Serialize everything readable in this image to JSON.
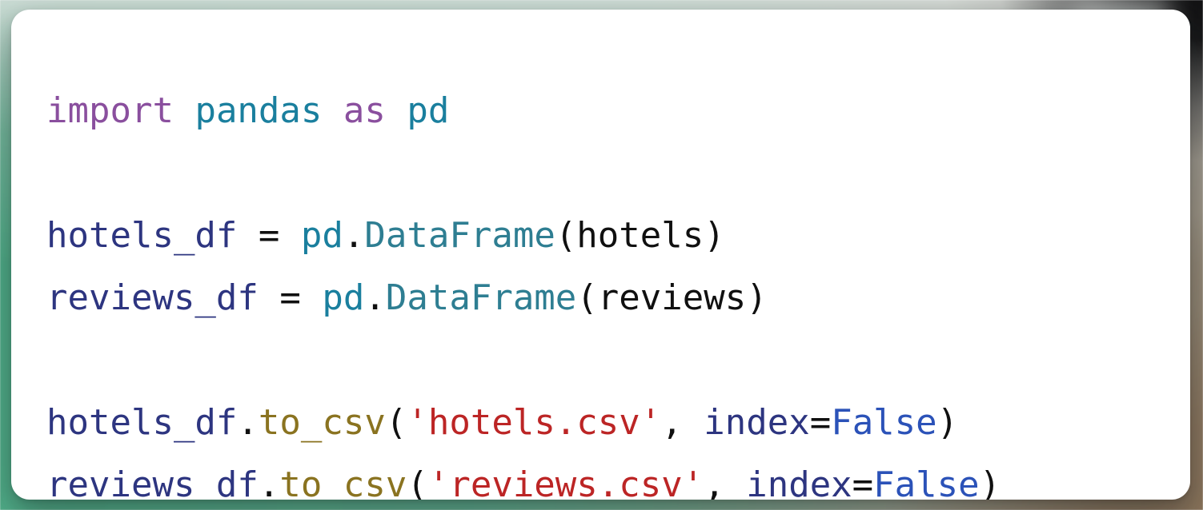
{
  "card": {
    "background_color": "#ffffff",
    "corner_radius_px": 23
  },
  "backdrop": {
    "description": "blurred photographic background",
    "green": "#5cb491",
    "tan": "#8d7861",
    "dark": "#0a0a0c",
    "haze": "#e1e4e2"
  },
  "code": {
    "language": "python",
    "font_size_px": 44,
    "lines": [
      {
        "id": "line-1",
        "tokens": [
          {
            "text": "import",
            "type": "keyword"
          },
          {
            "text": " ",
            "type": "plain"
          },
          {
            "text": "pandas",
            "type": "module"
          },
          {
            "text": " ",
            "type": "plain"
          },
          {
            "text": "as",
            "type": "keyword"
          },
          {
            "text": " ",
            "type": "plain"
          },
          {
            "text": "pd",
            "type": "module"
          }
        ]
      },
      {
        "id": "line-2",
        "tokens": []
      },
      {
        "id": "line-3",
        "tokens": [
          {
            "text": "hotels_df",
            "type": "var"
          },
          {
            "text": " = ",
            "type": "plain"
          },
          {
            "text": "pd",
            "type": "module"
          },
          {
            "text": ".",
            "type": "plain"
          },
          {
            "text": "DataFrame",
            "type": "class"
          },
          {
            "text": "(hotels)",
            "type": "plain"
          }
        ]
      },
      {
        "id": "line-4",
        "tokens": [
          {
            "text": "reviews_df",
            "type": "var"
          },
          {
            "text": " = ",
            "type": "plain"
          },
          {
            "text": "pd",
            "type": "module"
          },
          {
            "text": ".",
            "type": "plain"
          },
          {
            "text": "DataFrame",
            "type": "class"
          },
          {
            "text": "(reviews)",
            "type": "plain"
          }
        ]
      },
      {
        "id": "line-5",
        "tokens": []
      },
      {
        "id": "line-6",
        "tokens": [
          {
            "text": "hotels_df",
            "type": "var"
          },
          {
            "text": ".",
            "type": "plain"
          },
          {
            "text": "to_csv",
            "type": "method"
          },
          {
            "text": "(",
            "type": "plain"
          },
          {
            "text": "'hotels.csv'",
            "type": "string"
          },
          {
            "text": ", ",
            "type": "plain"
          },
          {
            "text": "index",
            "type": "var"
          },
          {
            "text": "=",
            "type": "plain"
          },
          {
            "text": "False",
            "type": "const"
          },
          {
            "text": ")",
            "type": "plain"
          }
        ]
      },
      {
        "id": "line-7",
        "tokens": [
          {
            "text": "reviews_df",
            "type": "var"
          },
          {
            "text": ".",
            "type": "plain"
          },
          {
            "text": "to_csv",
            "type": "method"
          },
          {
            "text": "(",
            "type": "plain"
          },
          {
            "text": "'reviews.csv'",
            "type": "string"
          },
          {
            "text": ", ",
            "type": "plain"
          },
          {
            "text": "index",
            "type": "var"
          },
          {
            "text": "=",
            "type": "plain"
          },
          {
            "text": "False",
            "type": "const"
          },
          {
            "text": ")",
            "type": "plain"
          }
        ]
      }
    ],
    "plain_text": "import pandas as pd\n\nhotels_df = pd.DataFrame(hotels)\nreviews_df = pd.DataFrame(reviews)\n\nhotels_df.to_csv('hotels.csv', index=False)\nreviews_df.to_csv('reviews.csv', index=False)",
    "token_colors": {
      "keyword": "#8a4f9e",
      "module": "#1a7f9e",
      "plain": "#101010",
      "var": "#2d3580",
      "class": "#2e7e92",
      "method": "#8a7320",
      "string": "#bc2525",
      "const": "#2b52b8"
    }
  }
}
